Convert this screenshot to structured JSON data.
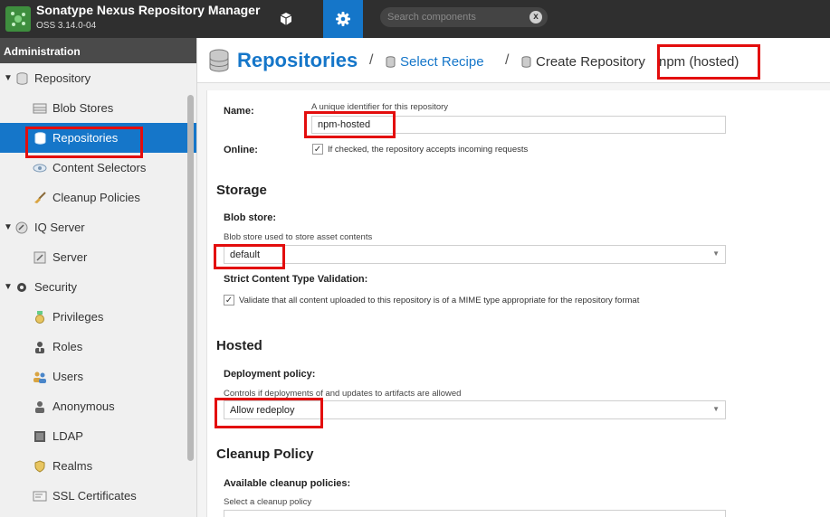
{
  "header": {
    "app_title": "Sonatype Nexus Repository Manager",
    "app_version": "OSS 3.14.0-04",
    "search_placeholder": "Search components",
    "clear_symbol": "x",
    "accent_color": "#1576c9"
  },
  "sidebar": {
    "header": "Administration",
    "items": [
      {
        "label": "Repository",
        "icon": "database-icon",
        "type": "group",
        "expanded": true
      },
      {
        "label": "Blob Stores",
        "icon": "server-stack-icon",
        "type": "child"
      },
      {
        "label": "Repositories",
        "icon": "database-icon",
        "type": "child",
        "selected": true
      },
      {
        "label": "Content Selectors",
        "icon": "eye-icon",
        "type": "child"
      },
      {
        "label": "Cleanup Policies",
        "icon": "broom-icon",
        "type": "child"
      },
      {
        "label": "IQ Server",
        "icon": "iq-icon",
        "type": "group",
        "expanded": true
      },
      {
        "label": "Server",
        "icon": "server-icon",
        "type": "child"
      },
      {
        "label": "Security",
        "icon": "gear-dark-icon",
        "type": "group",
        "expanded": true
      },
      {
        "label": "Privileges",
        "icon": "medal-icon",
        "type": "child"
      },
      {
        "label": "Roles",
        "icon": "role-icon",
        "type": "child"
      },
      {
        "label": "Users",
        "icon": "users-icon",
        "type": "child"
      },
      {
        "label": "Anonymous",
        "icon": "person-icon",
        "type": "child"
      },
      {
        "label": "LDAP",
        "icon": "book-icon",
        "type": "child"
      },
      {
        "label": "Realms",
        "icon": "shield-icon",
        "type": "child"
      },
      {
        "label": "SSL Certificates",
        "icon": "certificate-icon",
        "type": "child"
      }
    ]
  },
  "breadcrumb": {
    "title": "Repositories",
    "sep": "/",
    "recipe": "Select Recipe",
    "create": "Create Repository",
    "format": "npm (hosted)"
  },
  "form": {
    "name_label": "Name:",
    "name_help": "A unique identifier for this repository",
    "name_value": "npm-hosted",
    "online_label": "Online:",
    "online_help": "If checked, the repository accepts incoming requests",
    "online_checked": true,
    "storage_section": "Storage",
    "blob_label": "Blob store:",
    "blob_help": "Blob store used to store asset contents",
    "blob_value": "default",
    "strict_label": "Strict Content Type Validation:",
    "strict_help": "Validate that all content uploaded to this repository is of a MIME type appropriate for the repository format",
    "strict_checked": true,
    "hosted_section": "Hosted",
    "deploy_label": "Deployment policy:",
    "deploy_help": "Controls if deployments of and updates to artifacts are allowed",
    "deploy_value": "Allow redeploy",
    "cleanup_section": "Cleanup Policy",
    "cleanup_label": "Available cleanup policies:",
    "cleanup_help": "Select a cleanup policy",
    "check_mark": "✓",
    "caret": "▼"
  },
  "highlight_color": "#e30d0d"
}
